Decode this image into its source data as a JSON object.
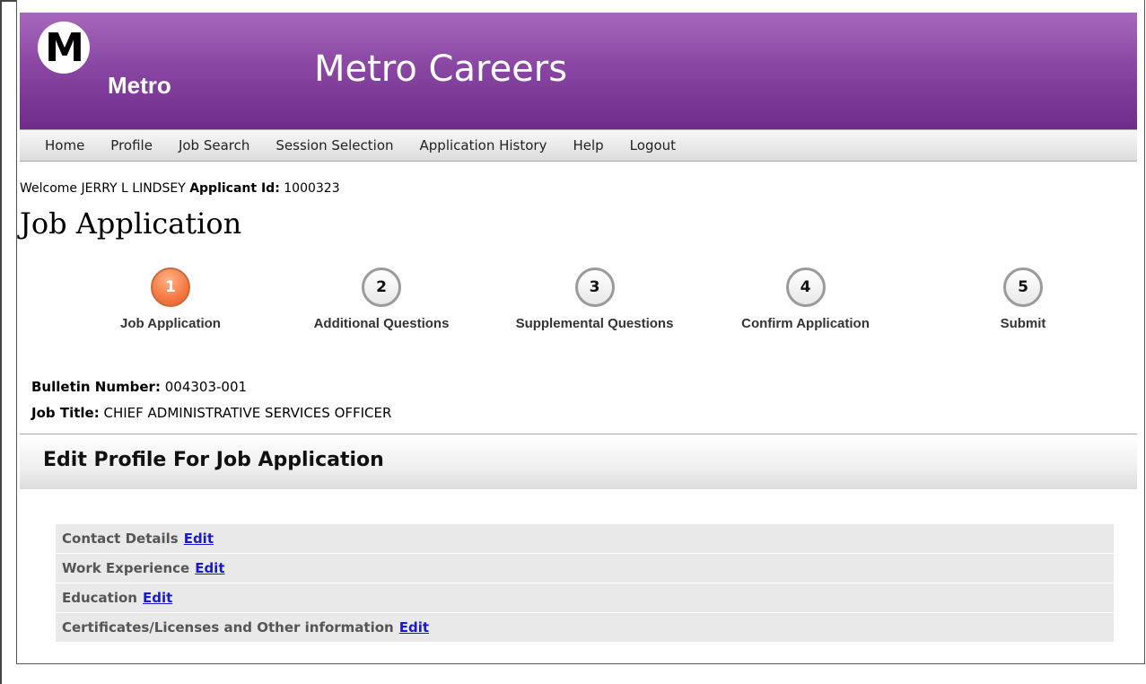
{
  "header": {
    "logo_letter": "M",
    "logo_text": "Metro",
    "site_title": "Metro Careers"
  },
  "nav": {
    "items": [
      "Home",
      "Profile",
      "Job Search",
      "Session Selection",
      "Application History",
      "Help",
      "Logout"
    ]
  },
  "welcome": {
    "prefix": "Welcome JERRY L LINDSEY",
    "applicant_label": "Applicant Id:",
    "applicant_id": "1000323"
  },
  "page_title": "Job Application",
  "steps": [
    {
      "number": "1",
      "label": "Job Application",
      "active": true
    },
    {
      "number": "2",
      "label": "Additional Questions",
      "active": false
    },
    {
      "number": "3",
      "label": "Supplemental Questions",
      "active": false
    },
    {
      "number": "4",
      "label": "Confirm Application",
      "active": false
    },
    {
      "number": "5",
      "label": "Submit",
      "active": false
    }
  ],
  "job": {
    "bulletin_label": "Bulletin Number:",
    "bulletin_value": "004303-001",
    "title_label": "Job Title:",
    "title_value": "CHIEF ADMINISTRATIVE SERVICES OFFICER"
  },
  "section": {
    "title": "Edit Profile For Job Application",
    "rows": [
      {
        "label": "Contact Details",
        "link": "Edit"
      },
      {
        "label": "Work Experience",
        "link": "Edit"
      },
      {
        "label": "Education",
        "link": "Edit"
      },
      {
        "label": "Certificates/Licenses and Other information",
        "link": "Edit"
      }
    ]
  },
  "colors": {
    "header_purple": "#8a47a3",
    "active_step": "#f57d46",
    "link_blue": "#1a1acc"
  }
}
